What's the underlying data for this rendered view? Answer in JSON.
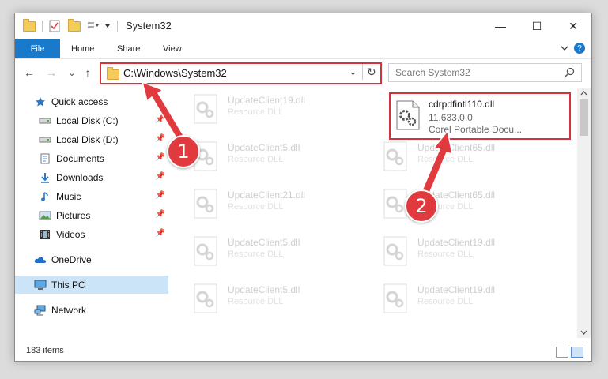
{
  "window": {
    "title": "System32",
    "minimize": "—",
    "maximize": "☐",
    "close": "✕"
  },
  "ribbon": {
    "tabs": [
      "File",
      "Home",
      "Share",
      "View"
    ]
  },
  "address": {
    "path": "C:\\Windows\\System32",
    "dropdown": "⌄",
    "refresh": "↻"
  },
  "search": {
    "placeholder": "Search System32"
  },
  "nav": {
    "back": "←",
    "forward": "→",
    "recent": "⌄",
    "up": "↑",
    "items": [
      {
        "label": "Quick access",
        "icon": "star-icon"
      },
      {
        "label": "Local Disk (C:)",
        "icon": "drive-icon"
      },
      {
        "label": "Local Disk (D:)",
        "icon": "drive-icon"
      },
      {
        "label": "Documents",
        "icon": "documents-icon"
      },
      {
        "label": "Downloads",
        "icon": "download-icon"
      },
      {
        "label": "Music",
        "icon": "music-icon"
      },
      {
        "label": "Pictures",
        "icon": "pictures-icon"
      },
      {
        "label": "Videos",
        "icon": "videos-icon"
      },
      {
        "label": "OneDrive",
        "icon": "cloud-icon"
      },
      {
        "label": "This PC",
        "icon": "computer-icon"
      },
      {
        "label": "Network",
        "icon": "network-icon"
      }
    ]
  },
  "files": [
    {
      "name": "UpdateClient19.dll",
      "type": "Resource DLL"
    },
    {
      "name": "UpdateClient5.dll",
      "type": "Resource DLL"
    },
    {
      "name": "UpdateClient65.dll",
      "type": "Resource DLL"
    },
    {
      "name": "UpdateClient21.dll",
      "type": "Resource DLL"
    },
    {
      "name": "UpdateClient65.dll",
      "type": "Resource DLL"
    },
    {
      "name": "UpdateClient5.dll",
      "type": "Resource DLL"
    },
    {
      "name": "UpdateClient19.dll",
      "type": "Resource DLL"
    },
    {
      "name": "UpdateClient5.dll",
      "type": "Resource DLL"
    },
    {
      "name": "UpdateClient19.dll",
      "type": "Resource DLL"
    }
  ],
  "highlighted_file": {
    "name": "cdrpdfintl110.dll",
    "version": "11.633.0.0",
    "description": "Corel Portable Docu..."
  },
  "status": {
    "count": "183 items"
  },
  "annotations": {
    "step1": "1",
    "step2": "2"
  },
  "colors": {
    "accent": "#1979ca",
    "highlight": "#d6323a"
  }
}
